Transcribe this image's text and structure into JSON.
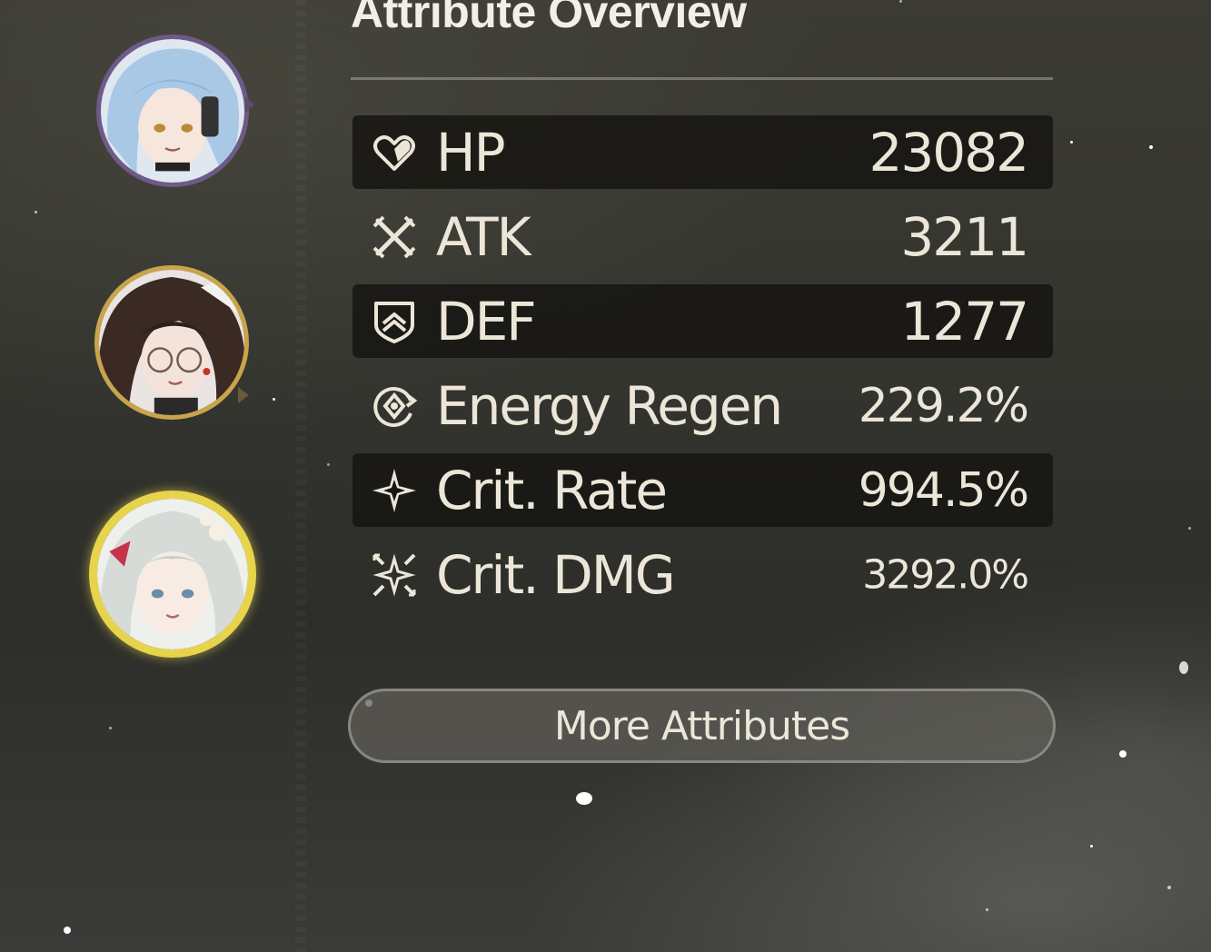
{
  "panel": {
    "title": "Attribute Overview",
    "more_button_label": "More Attributes"
  },
  "team": [
    {
      "name_icon": "character-avatar-blue-hair",
      "ring_color": "#6e5a8a"
    },
    {
      "name_icon": "character-avatar-dark-hair-glasses",
      "ring_color": "#c9a44a"
    },
    {
      "name_icon": "character-avatar-white-hair",
      "ring_color": "#e8d44c",
      "selected": true
    }
  ],
  "attributes": [
    {
      "icon": "heart-icon",
      "label": "HP",
      "value": "23082",
      "shaded": true
    },
    {
      "icon": "crossed-swords-icon",
      "label": "ATK",
      "value": "3211",
      "shaded": false
    },
    {
      "icon": "shield-icon",
      "label": "DEF",
      "value": "1277",
      "shaded": true
    },
    {
      "icon": "energy-regen-icon",
      "label": "Energy Regen",
      "value": "229.2%",
      "shaded": false
    },
    {
      "icon": "crit-rate-star-icon",
      "label": "Crit. Rate",
      "value": "994.5%",
      "shaded": true
    },
    {
      "icon": "crit-dmg-burst-icon",
      "label": "Crit. DMG",
      "value": "3292.0%",
      "shaded": false
    }
  ],
  "colors": {
    "text": "#ece6d8",
    "row_shade": "#161512",
    "selected_ring": "#e8d44c"
  }
}
